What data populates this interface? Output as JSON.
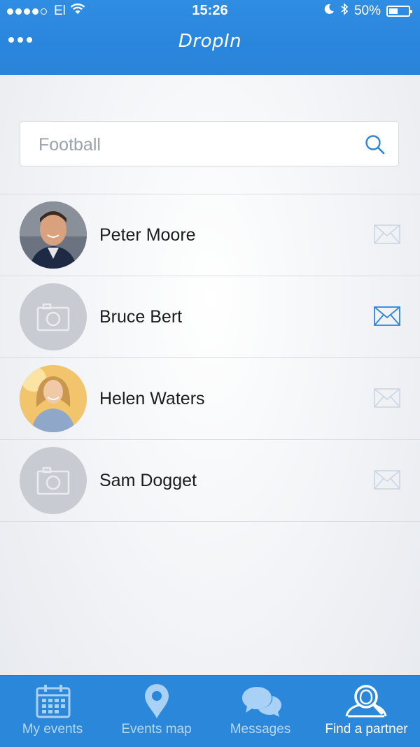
{
  "status_bar": {
    "carrier": "El",
    "time": "15:26",
    "battery": "50%"
  },
  "header": {
    "logo_text": "DropIn"
  },
  "search": {
    "placeholder": "Football"
  },
  "people": [
    {
      "name": "Peter Moore",
      "avatar": "photo",
      "message_active": false
    },
    {
      "name": "Bruce Bert",
      "avatar": "placeholder",
      "message_active": true
    },
    {
      "name": "Helen Waters",
      "avatar": "photo",
      "message_active": false
    },
    {
      "name": "Sam Dogget",
      "avatar": "placeholder",
      "message_active": false
    }
  ],
  "tabs": [
    {
      "label": "My events",
      "icon": "calendar-icon",
      "active": false
    },
    {
      "label": "Events map",
      "icon": "map-pin-icon",
      "active": false
    },
    {
      "label": "Messages",
      "icon": "chat-bubbles-icon",
      "active": false
    },
    {
      "label": "Find a partner",
      "icon": "find-partner-icon",
      "active": true
    }
  ],
  "colors": {
    "brand_blue": "#2a86dc",
    "tabbar_blue": "#2b87da",
    "active_mail": "#2f85d8",
    "inactive_mail": "#c9d6e3",
    "placeholder_avatar": "#c8ccd2"
  }
}
